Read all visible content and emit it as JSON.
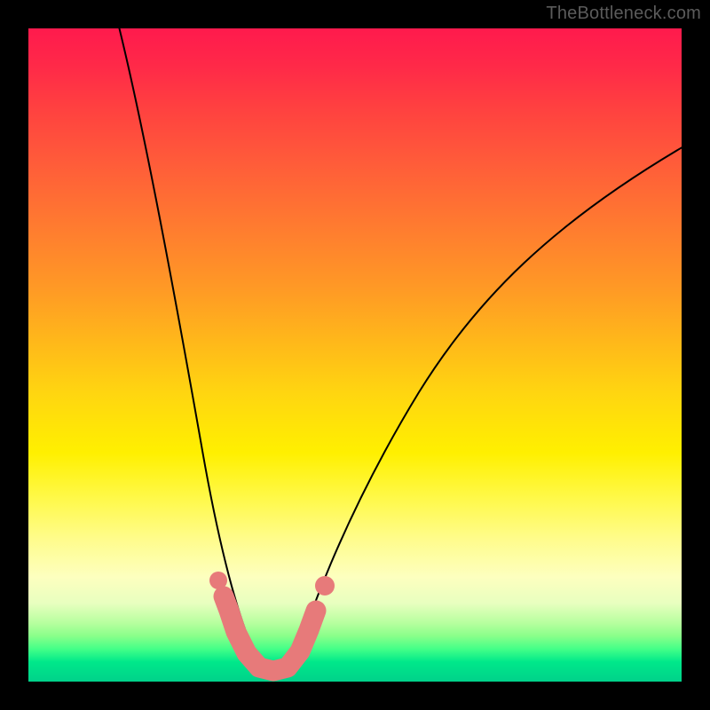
{
  "watermark": "TheBottleneck.com",
  "chart_data": {
    "type": "line",
    "title": "",
    "xlabel": "",
    "ylabel": "",
    "xlim": [
      0,
      100
    ],
    "ylim": [
      0,
      100
    ],
    "grid": false,
    "background": "heatmap-vertical-gradient",
    "series": [
      {
        "name": "left-arm",
        "x": [
          14,
          16,
          18,
          20,
          22,
          24,
          26,
          27,
          28,
          29,
          30,
          31,
          32,
          33,
          34,
          35,
          36,
          37,
          38
        ],
        "y": [
          100,
          90,
          80,
          70,
          60,
          48,
          36,
          30,
          24,
          18,
          14,
          10,
          7,
          5,
          3.5,
          2.5,
          2,
          1.7,
          1.5
        ]
      },
      {
        "name": "right-arm",
        "x": [
          38,
          40,
          42,
          44,
          47,
          50,
          54,
          58,
          63,
          68,
          74,
          80,
          86,
          92,
          100
        ],
        "y": [
          1.5,
          2.5,
          5,
          9,
          15,
          22,
          30,
          38,
          46,
          53,
          60,
          66,
          71,
          76,
          82
        ]
      }
    ],
    "highlight_segment": {
      "name": "pink-bottom-highlight",
      "color": "#e77a7a",
      "x": [
        30,
        31.5,
        33,
        35,
        37,
        39,
        41,
        42.5,
        44
      ],
      "y": [
        12,
        8,
        5,
        2.5,
        1.5,
        1.5,
        4,
        7,
        11
      ],
      "isolated_point": {
        "x": 45.5,
        "y": 15
      }
    },
    "gradient_stops": [
      {
        "pos": 0.0,
        "color": "#ff1a4d"
      },
      {
        "pos": 0.3,
        "color": "#ff7a30"
      },
      {
        "pos": 0.65,
        "color": "#fff000"
      },
      {
        "pos": 0.9,
        "color": "#b7ff9f"
      },
      {
        "pos": 1.0,
        "color": "#00d28a"
      }
    ]
  }
}
